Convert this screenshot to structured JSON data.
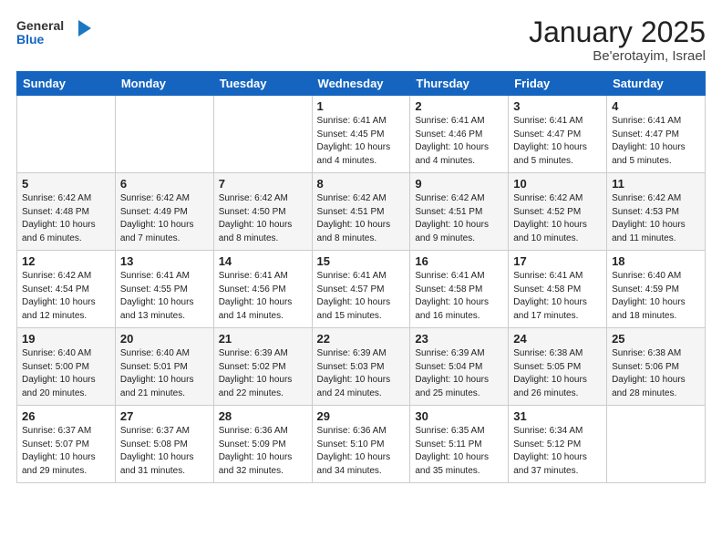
{
  "header": {
    "logo_general": "General",
    "logo_blue": "Blue",
    "month_title": "January 2025",
    "location": "Be'erotayim, Israel"
  },
  "weekdays": [
    "Sunday",
    "Monday",
    "Tuesday",
    "Wednesday",
    "Thursday",
    "Friday",
    "Saturday"
  ],
  "weeks": [
    [
      {
        "day": "",
        "info": ""
      },
      {
        "day": "",
        "info": ""
      },
      {
        "day": "",
        "info": ""
      },
      {
        "day": "1",
        "info": "Sunrise: 6:41 AM\nSunset: 4:45 PM\nDaylight: 10 hours\nand 4 minutes."
      },
      {
        "day": "2",
        "info": "Sunrise: 6:41 AM\nSunset: 4:46 PM\nDaylight: 10 hours\nand 4 minutes."
      },
      {
        "day": "3",
        "info": "Sunrise: 6:41 AM\nSunset: 4:47 PM\nDaylight: 10 hours\nand 5 minutes."
      },
      {
        "day": "4",
        "info": "Sunrise: 6:41 AM\nSunset: 4:47 PM\nDaylight: 10 hours\nand 5 minutes."
      }
    ],
    [
      {
        "day": "5",
        "info": "Sunrise: 6:42 AM\nSunset: 4:48 PM\nDaylight: 10 hours\nand 6 minutes."
      },
      {
        "day": "6",
        "info": "Sunrise: 6:42 AM\nSunset: 4:49 PM\nDaylight: 10 hours\nand 7 minutes."
      },
      {
        "day": "7",
        "info": "Sunrise: 6:42 AM\nSunset: 4:50 PM\nDaylight: 10 hours\nand 8 minutes."
      },
      {
        "day": "8",
        "info": "Sunrise: 6:42 AM\nSunset: 4:51 PM\nDaylight: 10 hours\nand 8 minutes."
      },
      {
        "day": "9",
        "info": "Sunrise: 6:42 AM\nSunset: 4:51 PM\nDaylight: 10 hours\nand 9 minutes."
      },
      {
        "day": "10",
        "info": "Sunrise: 6:42 AM\nSunset: 4:52 PM\nDaylight: 10 hours\nand 10 minutes."
      },
      {
        "day": "11",
        "info": "Sunrise: 6:42 AM\nSunset: 4:53 PM\nDaylight: 10 hours\nand 11 minutes."
      }
    ],
    [
      {
        "day": "12",
        "info": "Sunrise: 6:42 AM\nSunset: 4:54 PM\nDaylight: 10 hours\nand 12 minutes."
      },
      {
        "day": "13",
        "info": "Sunrise: 6:41 AM\nSunset: 4:55 PM\nDaylight: 10 hours\nand 13 minutes."
      },
      {
        "day": "14",
        "info": "Sunrise: 6:41 AM\nSunset: 4:56 PM\nDaylight: 10 hours\nand 14 minutes."
      },
      {
        "day": "15",
        "info": "Sunrise: 6:41 AM\nSunset: 4:57 PM\nDaylight: 10 hours\nand 15 minutes."
      },
      {
        "day": "16",
        "info": "Sunrise: 6:41 AM\nSunset: 4:58 PM\nDaylight: 10 hours\nand 16 minutes."
      },
      {
        "day": "17",
        "info": "Sunrise: 6:41 AM\nSunset: 4:58 PM\nDaylight: 10 hours\nand 17 minutes."
      },
      {
        "day": "18",
        "info": "Sunrise: 6:40 AM\nSunset: 4:59 PM\nDaylight: 10 hours\nand 18 minutes."
      }
    ],
    [
      {
        "day": "19",
        "info": "Sunrise: 6:40 AM\nSunset: 5:00 PM\nDaylight: 10 hours\nand 20 minutes."
      },
      {
        "day": "20",
        "info": "Sunrise: 6:40 AM\nSunset: 5:01 PM\nDaylight: 10 hours\nand 21 minutes."
      },
      {
        "day": "21",
        "info": "Sunrise: 6:39 AM\nSunset: 5:02 PM\nDaylight: 10 hours\nand 22 minutes."
      },
      {
        "day": "22",
        "info": "Sunrise: 6:39 AM\nSunset: 5:03 PM\nDaylight: 10 hours\nand 24 minutes."
      },
      {
        "day": "23",
        "info": "Sunrise: 6:39 AM\nSunset: 5:04 PM\nDaylight: 10 hours\nand 25 minutes."
      },
      {
        "day": "24",
        "info": "Sunrise: 6:38 AM\nSunset: 5:05 PM\nDaylight: 10 hours\nand 26 minutes."
      },
      {
        "day": "25",
        "info": "Sunrise: 6:38 AM\nSunset: 5:06 PM\nDaylight: 10 hours\nand 28 minutes."
      }
    ],
    [
      {
        "day": "26",
        "info": "Sunrise: 6:37 AM\nSunset: 5:07 PM\nDaylight: 10 hours\nand 29 minutes."
      },
      {
        "day": "27",
        "info": "Sunrise: 6:37 AM\nSunset: 5:08 PM\nDaylight: 10 hours\nand 31 minutes."
      },
      {
        "day": "28",
        "info": "Sunrise: 6:36 AM\nSunset: 5:09 PM\nDaylight: 10 hours\nand 32 minutes."
      },
      {
        "day": "29",
        "info": "Sunrise: 6:36 AM\nSunset: 5:10 PM\nDaylight: 10 hours\nand 34 minutes."
      },
      {
        "day": "30",
        "info": "Sunrise: 6:35 AM\nSunset: 5:11 PM\nDaylight: 10 hours\nand 35 minutes."
      },
      {
        "day": "31",
        "info": "Sunrise: 6:34 AM\nSunset: 5:12 PM\nDaylight: 10 hours\nand 37 minutes."
      },
      {
        "day": "",
        "info": ""
      }
    ]
  ]
}
